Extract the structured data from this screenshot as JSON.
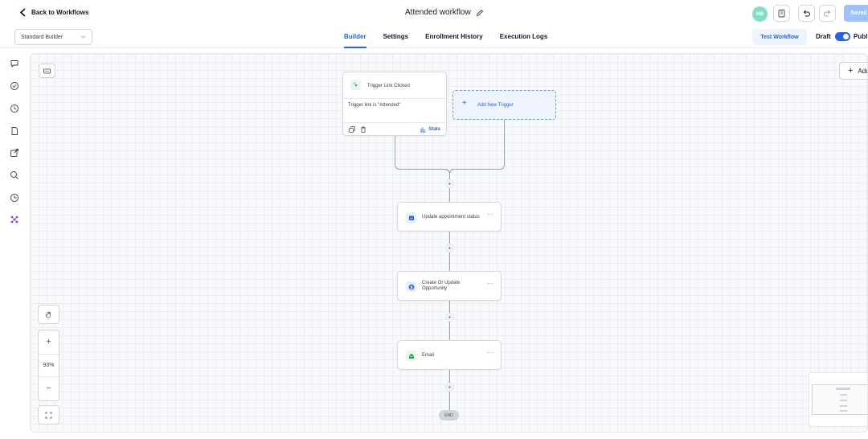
{
  "header": {
    "back_label": "Back to Workflows",
    "workflow_title": "Attended workflow",
    "avatar_initials": "MB",
    "saved_label": "Saved"
  },
  "subbar": {
    "builder_select": "Standard Builder",
    "tabs": [
      {
        "label": "Builder",
        "active": true
      },
      {
        "label": "Settings",
        "active": false
      },
      {
        "label": "Enrollment History",
        "active": false
      },
      {
        "label": "Execution Logs",
        "active": false
      }
    ],
    "test_workflow_label": "Test Workflow",
    "draft_label": "Draft",
    "publish_label": "Publi"
  },
  "sidebar": {
    "icons": [
      "chat-icon",
      "check-circle-icon",
      "history-icon",
      "document-icon",
      "external-link-icon",
      "search-icon",
      "time-icon",
      "workflow-icon"
    ]
  },
  "canvas": {
    "add_label": "Add",
    "zoom_level": "93%",
    "trigger": {
      "title": "Trigger Link Clicked",
      "condition": "Trigger link is \"Attended\"",
      "stats_label": "Stats"
    },
    "add_trigger_label": "Add New Trigger",
    "actions": [
      {
        "label": "Update appointment status",
        "icon": "calendar-icon",
        "color": "#2563eb"
      },
      {
        "label": "Create Or Update Opportunity",
        "icon": "dollar-icon",
        "color": "#2563eb"
      },
      {
        "label": "Email",
        "icon": "envelope-icon",
        "color": "#16a34a"
      }
    ],
    "end_label": "END"
  },
  "colors": {
    "accent": "#2563eb",
    "avatar": "#7ee0c9",
    "saved_button": "#9ec2f7"
  }
}
